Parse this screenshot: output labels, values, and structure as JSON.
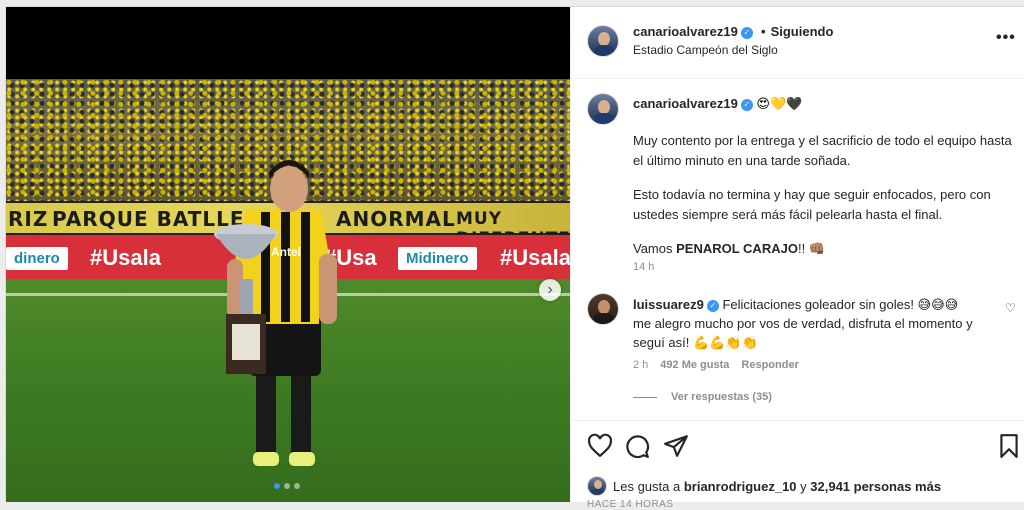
{
  "post": {
    "author": "canarioalvarez19",
    "follow_status": "Siguiendo",
    "location": "Estadio Campeón del Siglo",
    "more_icon": "more-options-icon"
  },
  "photo": {
    "banner_text_1": "RIZ",
    "banner_text_2": "PARQUE BATLLE",
    "banner_text_3": "ANORMAL",
    "banner_text_4": "MUY DIFERENTE A",
    "ad_1": "#Usala",
    "ad_2": "#Usa",
    "ad_3": "#Usala",
    "ad_brand": "Midinero",
    "ad_brand_left": "dinero",
    "shirt_sponsor": "Antel",
    "carousel_next": "›",
    "slide_count": 3
  },
  "caption": {
    "author": "canarioalvarez19",
    "emojis": "😍💛🖤",
    "para1": "Muy contento por la entrega y el sacrificio de todo el equipo hasta el último minuto en una tarde soñada.",
    "para2": "Esto todavía no termina y hay que seguir enfocados, pero con ustedes siempre será más fácil pelearla hasta el final.",
    "para3_start": "Vamos ",
    "para3_bold": "PENAROL CARAJO",
    "para3_end": "!! 👊🏽",
    "time": "14 h"
  },
  "comment": {
    "author": "luissuarez9",
    "text": "Felicitaciones goleador sin goles! 😅😅😅 me alegro mucho por vos de verdad, disfruta el momento y seguí así! 💪💪👏👏",
    "time": "2 h",
    "likes": "492 Me gusta",
    "reply": "Responder",
    "view_replies": "Ver respuestas (35)"
  },
  "footer": {
    "likes_prefix": "Les gusta a ",
    "likes_user": "brianrodriguez_10",
    "likes_mid": " y ",
    "likes_count": "32,941 personas más",
    "posted_time": "HACE 14 HORAS"
  }
}
